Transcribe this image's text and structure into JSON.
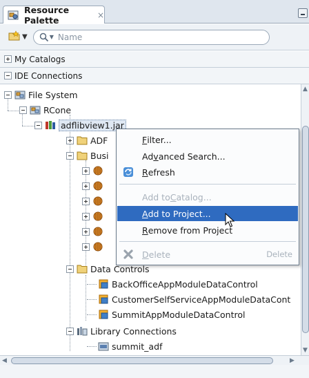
{
  "palette": {
    "tab_title": "Resource Palette",
    "tab_close": "×",
    "search_placeholder": "Name"
  },
  "sections": {
    "my_catalogs": "My Catalogs",
    "ide_connections": "IDE Connections"
  },
  "tree": {
    "file_system": "File System",
    "rcone": "RCone",
    "jar": "adflibview1.jar",
    "adf": "ADF",
    "busi": "Busi",
    "data_controls": "Data Controls",
    "dc_items": [
      "BackOfficeAppModuleDataControl",
      "CustomerSelfServiceAppModuleDataCont",
      "SummitAppModuleDataControl"
    ],
    "library_connections": "Library Connections",
    "summit_adf": "summit_adf"
  },
  "menu": {
    "filter": {
      "pre": "",
      "u": "F",
      "post": "ilter..."
    },
    "advanced": {
      "pre": "Ad",
      "u": "v",
      "post": "anced Search..."
    },
    "refresh": {
      "pre": "",
      "u": "R",
      "post": "efresh"
    },
    "add_catalog": {
      "pre": "Add to ",
      "u": "C",
      "post": "atalog..."
    },
    "add_project": {
      "pre": "",
      "u": "A",
      "post": "dd to Project..."
    },
    "remove_project": {
      "pre": "",
      "u": "R",
      "post": "emove from Project"
    },
    "delete": {
      "pre": "",
      "u": "D",
      "post": "elete"
    },
    "delete_shortcut": "Delete"
  },
  "colors": {
    "highlight": "#2f6bc0",
    "folder": "#f0d27a",
    "jar_red": "#c0392b",
    "jar_green": "#4a9a3a"
  }
}
